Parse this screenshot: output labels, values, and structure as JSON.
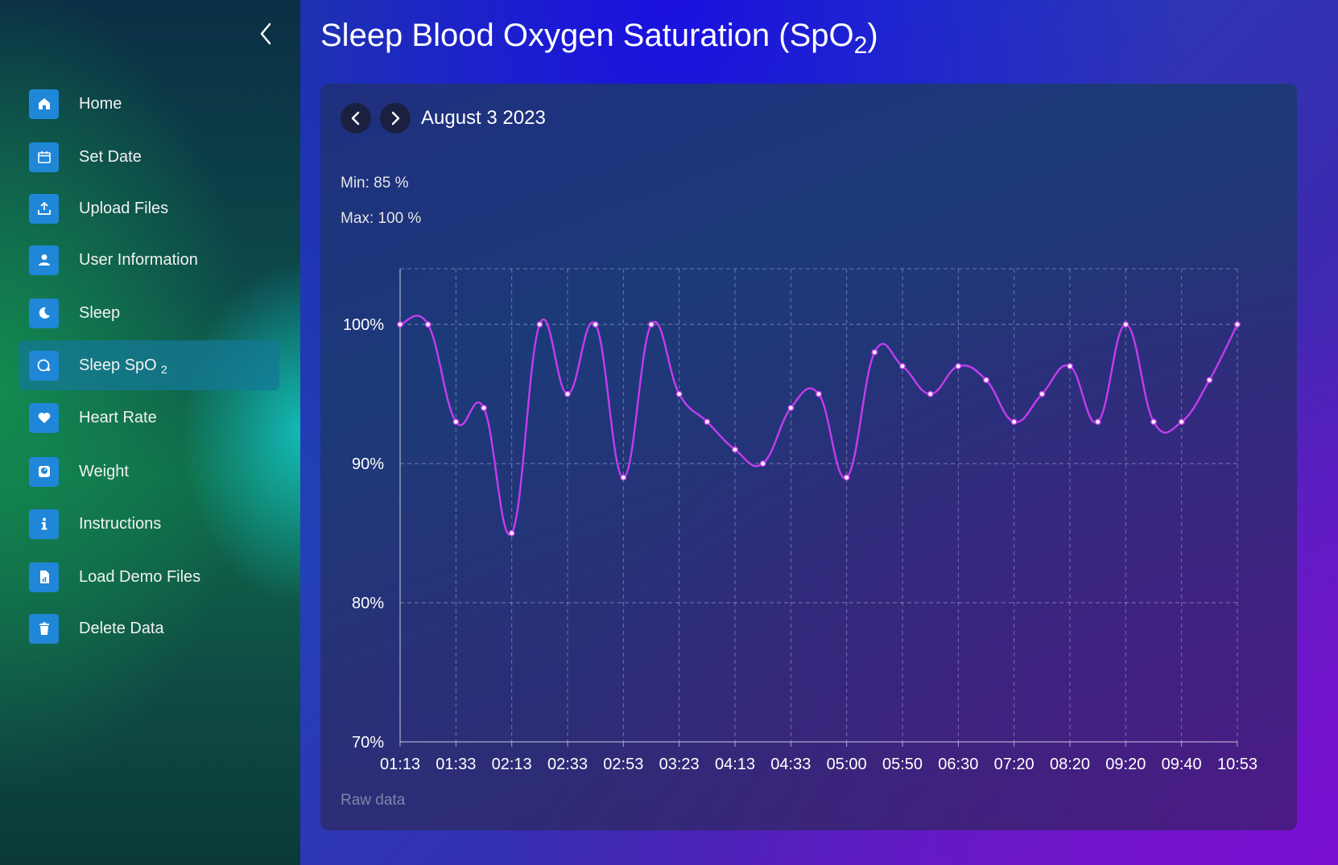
{
  "sidebar": {
    "items": [
      {
        "label": "Home",
        "icon": "home-icon"
      },
      {
        "label": "Set Date",
        "icon": "calendar-icon"
      },
      {
        "label": "Upload Files",
        "icon": "upload-icon"
      },
      {
        "label": "User Information",
        "icon": "user-icon"
      },
      {
        "label": "Sleep",
        "icon": "moon-icon"
      },
      {
        "label": "Sleep SpO",
        "sub": "2",
        "icon": "oxygen-icon",
        "active": true
      },
      {
        "label": "Heart Rate",
        "icon": "heart-icon"
      },
      {
        "label": "Weight",
        "icon": "scale-icon"
      },
      {
        "label": "Instructions",
        "icon": "info-icon"
      },
      {
        "label": "Load Demo Files",
        "icon": "file-icon"
      },
      {
        "label": "Delete Data",
        "icon": "trash-icon"
      }
    ]
  },
  "page": {
    "title": "Sleep Blood Oxygen Saturation (SpO",
    "title_sub": "2",
    "title_end": ")"
  },
  "panel": {
    "date": "August 3 2023",
    "min_text": "Min: 85 %",
    "max_text": "Max: 100 %",
    "raw_data_label": "Raw data"
  },
  "colors": {
    "icon_bg": "#1f86d8",
    "line": "#c43cf0",
    "active_item": "#147896"
  },
  "chart_data": {
    "type": "line",
    "x_tick_labels": [
      "01:13",
      "01:33",
      "02:13",
      "02:33",
      "02:53",
      "03:23",
      "04:13",
      "04:33",
      "05:00",
      "05:50",
      "06:30",
      "07:20",
      "08:20",
      "09:20",
      "09:40",
      "10:53"
    ],
    "values": [
      100,
      100,
      93,
      94,
      85,
      100,
      95,
      100,
      89,
      100,
      95,
      93,
      91,
      90,
      94,
      95,
      89,
      98,
      97,
      95,
      97,
      96,
      93,
      95,
      97,
      93,
      100,
      93,
      93,
      96,
      100
    ],
    "y_ticks": [
      70,
      80,
      90,
      100
    ],
    "y_tick_labels": [
      "70%",
      "80%",
      "90%",
      "100%"
    ],
    "ylim": [
      70,
      104
    ],
    "grid": true
  }
}
